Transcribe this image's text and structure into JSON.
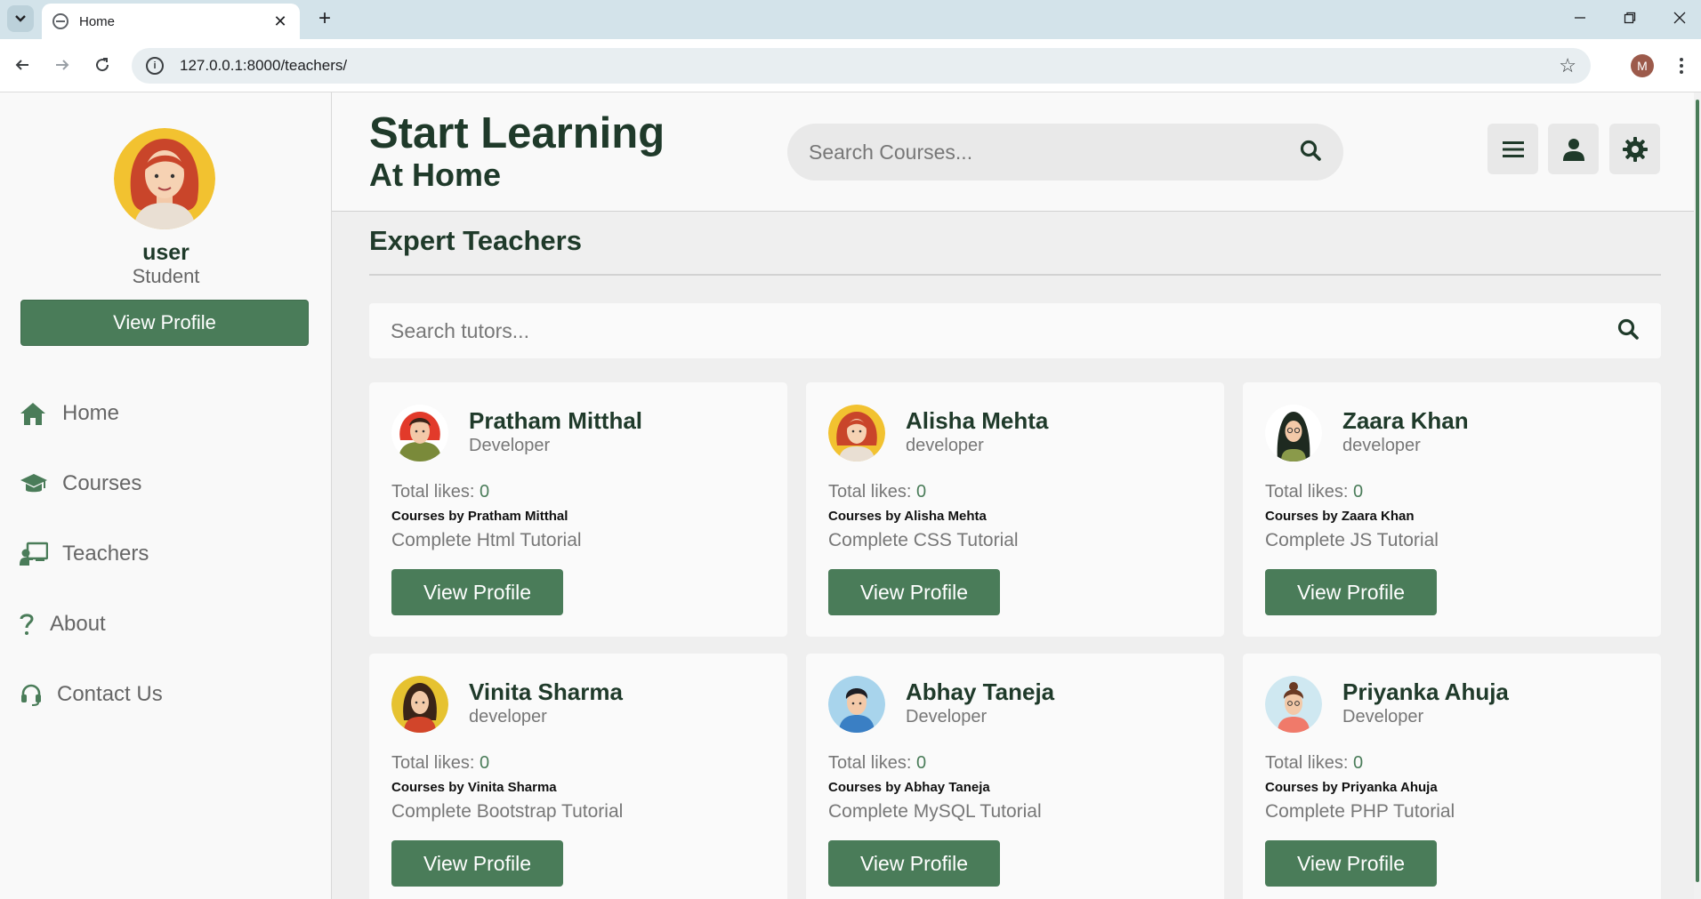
{
  "browser": {
    "tab_title": "Home",
    "url": "127.0.0.1:8000/teachers/",
    "profile_initial": "M"
  },
  "sidebar": {
    "user_name": "user",
    "user_role": "Student",
    "view_profile_label": "View Profile",
    "nav": [
      {
        "label": "Home",
        "icon": "home-icon"
      },
      {
        "label": "Courses",
        "icon": "graduation-cap-icon"
      },
      {
        "label": "Teachers",
        "icon": "chalkboard-teacher-icon"
      },
      {
        "label": "About",
        "icon": "question-icon"
      },
      {
        "label": "Contact Us",
        "icon": "headset-icon"
      }
    ]
  },
  "header": {
    "logo_line1": "Start Learning",
    "logo_line2": "At Home",
    "search_placeholder": "Search Courses..."
  },
  "main": {
    "section_title": "Expert Teachers",
    "tutor_search_placeholder": "Search tutors...",
    "likes_label": "Total likes:",
    "courses_by_prefix": "Courses by",
    "card_button_label": "View Profile",
    "teachers": [
      {
        "name": "Pratham Mitthal",
        "role": "Developer",
        "likes": "0",
        "courses_by": "Courses by Pratham Mitthal",
        "course": "Complete Html Tutorial"
      },
      {
        "name": "Alisha Mehta",
        "role": "developer",
        "likes": "0",
        "courses_by": "Courses by Alisha Mehta",
        "course": "Complete CSS Tutorial"
      },
      {
        "name": "Zaara Khan",
        "role": "developer",
        "likes": "0",
        "courses_by": "Courses by Zaara Khan",
        "course": "Complete JS Tutorial"
      },
      {
        "name": "Vinita Sharma",
        "role": "developer",
        "likes": "0",
        "courses_by": "Courses by Vinita Sharma",
        "course": "Complete Bootstrap Tutorial"
      },
      {
        "name": "Abhay Taneja",
        "role": "Developer",
        "likes": "0",
        "courses_by": "Courses by Abhay Taneja",
        "course": "Complete MySQL Tutorial"
      },
      {
        "name": "Priyanka Ahuja",
        "role": "Developer",
        "likes": "0",
        "courses_by": "Courses by Priyanka Ahuja",
        "course": "Complete PHP Tutorial"
      }
    ]
  },
  "colors": {
    "accent": "#4a7c59",
    "heading": "#1f3a2a"
  }
}
